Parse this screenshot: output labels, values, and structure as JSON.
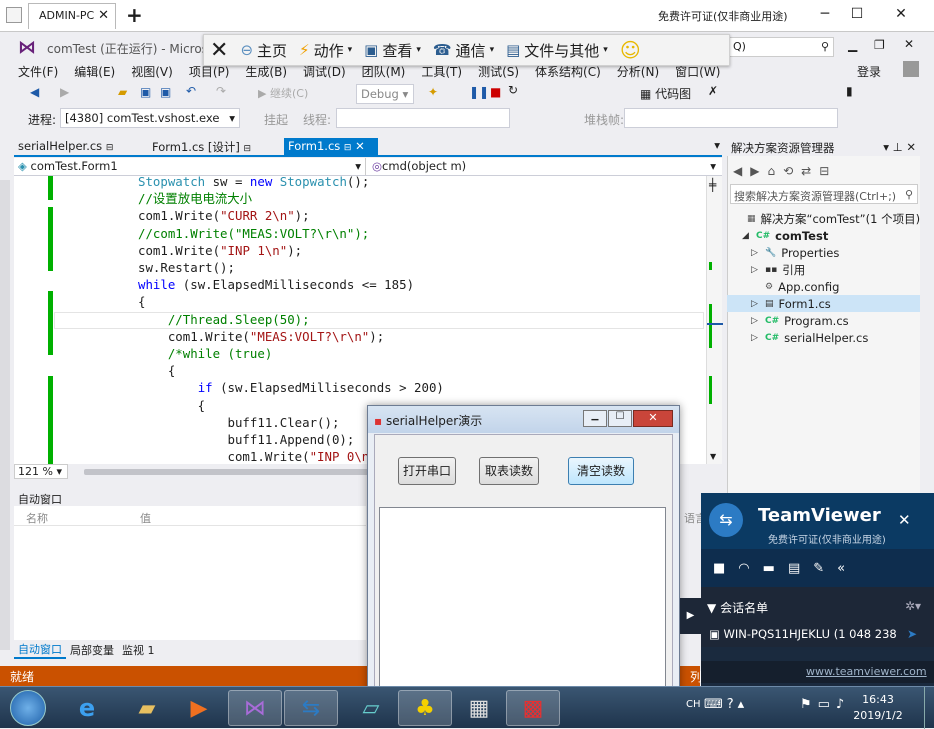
{
  "teamviewer": {
    "tab_title": "ADMIN-PC",
    "license": "免费许可证(仅非商业用途)",
    "toolbar": [
      {
        "label": "主页",
        "icon": "home-icon"
      },
      {
        "label": "动作",
        "icon": "lightning-icon"
      },
      {
        "label": "查看",
        "icon": "monitor-icon"
      },
      {
        "label": "通信",
        "icon": "phone-icon"
      },
      {
        "label": "文件与其他",
        "icon": "file-icon"
      }
    ],
    "panel": {
      "brand": "TeamViewer",
      "license": "免费许可证(仅非商业用途)",
      "session_header": "会话名单",
      "session_item": "WIN-PQS11HJEKLU (1 048 238",
      "url": "www.teamviewer.com"
    }
  },
  "vs": {
    "title": "comTest (正在运行) - Microsof",
    "quick_launch": "Q)",
    "login": "登录",
    "menu": [
      "文件(F)",
      "编辑(E)",
      "视图(V)",
      "项目(P)",
      "生成(B)",
      "调试(D)",
      "团队(M)",
      "工具(T)",
      "测试(S)",
      "体系结构(C)",
      "分析(N)",
      "窗口(W)"
    ],
    "toolbar": {
      "continue": "继续(C)",
      "config": "Debug",
      "code_map": "代码图"
    },
    "process_label": "进程:",
    "process_value": "[4380] comTest.vshost.exe",
    "hang": "挂起",
    "thread_label": "线程:",
    "stack_label": "堆栈帧:",
    "doc_tabs": [
      "serialHelper.cs",
      "Form1.cs [设计]",
      "Form1.cs"
    ],
    "nav_left": "comTest.Form1",
    "nav_right": "cmd(object m)",
    "zoom": "121 %",
    "autos": {
      "title": "自动窗口",
      "col_name": "名称",
      "col_value": "值",
      "col_lang": "语言"
    },
    "bottom_tabs": [
      "自动窗口",
      "局部变量",
      "监视 1"
    ],
    "status": "就绪",
    "status_right": "列",
    "solution": {
      "title": "解决方案资源管理器",
      "search": "搜索解决方案资源管理器(Ctrl+;)",
      "items": [
        {
          "label": "解决方案“comTest”(1 个项目)"
        },
        {
          "label": "comTest"
        },
        {
          "label": "Properties"
        },
        {
          "label": "引用"
        },
        {
          "label": "App.config"
        },
        {
          "label": "Form1.cs"
        },
        {
          "label": "Program.cs"
        },
        {
          "label": "serialHelper.cs"
        }
      ]
    },
    "code": [
      "Stopwatch sw = new Stopwatch();",
      "//设置放电电流大小",
      "com1.Write(\"CURR 2\\n\");",
      "//com1.Write(\"MEAS:VOLT?\\r\\n\");",
      "com1.Write(\"INP 1\\n\");",
      "sw.Restart();",
      "while (sw.ElapsedMilliseconds <= 185)",
      "{",
      "    //Thread.Sleep(50);",
      "    com1.Write(\"MEAS:VOLT?\\r\\n\");",
      "    /*while (true)",
      "    {",
      "        if (sw.ElapsedMilliseconds > 200)",
      "        {",
      "            buff11.Clear();",
      "            buff11.Append(0);",
      "            com1.Write(\"INP 0\\n\");"
    ]
  },
  "dialog": {
    "title": "serialHelper演示",
    "btn_open": "打开串口",
    "btn_read": "取表读数",
    "btn_clear": "清空读数"
  },
  "taskbar": {
    "lang": "CH",
    "time": "16:43",
    "date": "2019/1/2"
  }
}
